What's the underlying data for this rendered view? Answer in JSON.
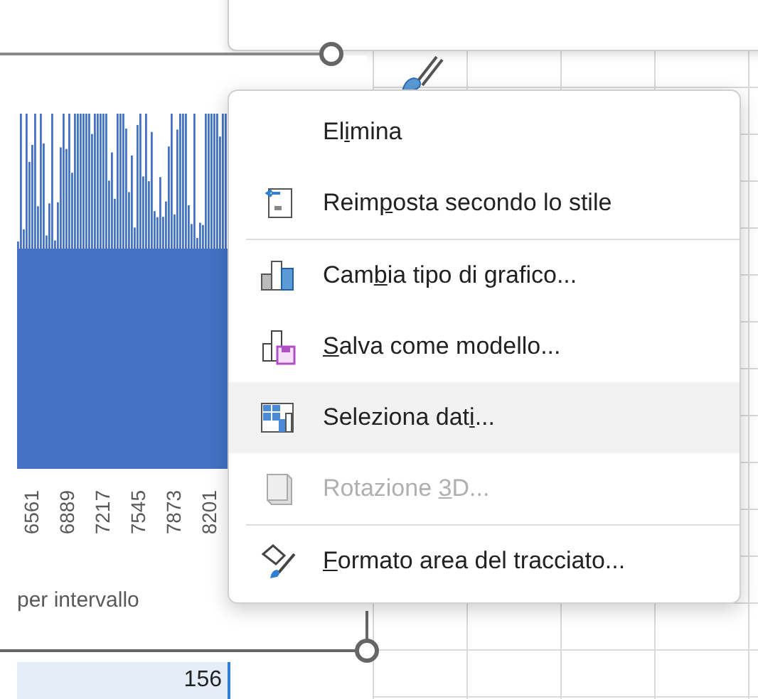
{
  "chart": {
    "axis_labels": [
      "6561",
      "6889",
      "7217",
      "7545",
      "7873",
      "8201"
    ],
    "axis_title": "per intervallo"
  },
  "cells": [
    {
      "value": "156",
      "selected": true
    }
  ],
  "context_menu": [
    {
      "kind": "none",
      "label_start": "El",
      "access_key": "i",
      "label_end": "mina",
      "disabled": false,
      "selected": false,
      "separator_after": false
    },
    {
      "kind": "reset",
      "label_start": "Reim",
      "access_key": "p",
      "label_end": "osta secondo lo stile",
      "disabled": false,
      "selected": false,
      "separator_after": true
    },
    {
      "kind": "chart-type",
      "label_start": "Cam",
      "access_key": "b",
      "label_end": "ia tipo di grafico...",
      "disabled": false,
      "selected": false,
      "separator_after": false
    },
    {
      "kind": "template",
      "access_key": "S",
      "label_end": "alva come modello...",
      "disabled": false,
      "selected": false,
      "separator_after": false
    },
    {
      "kind": "select-data",
      "label_start": "Seleziona dat",
      "access_key": "i",
      "label_end": "...",
      "disabled": false,
      "selected": true,
      "separator_after": false
    },
    {
      "kind": "rotation",
      "label_start": "Rotazione ",
      "access_key": "3",
      "label_end": "D...",
      "disabled": true,
      "selected": false,
      "separator_after": true
    },
    {
      "kind": "format",
      "access_key": "F",
      "label_end": "ormato area del tracciato...",
      "disabled": false,
      "selected": false,
      "separator_after": false
    }
  ]
}
